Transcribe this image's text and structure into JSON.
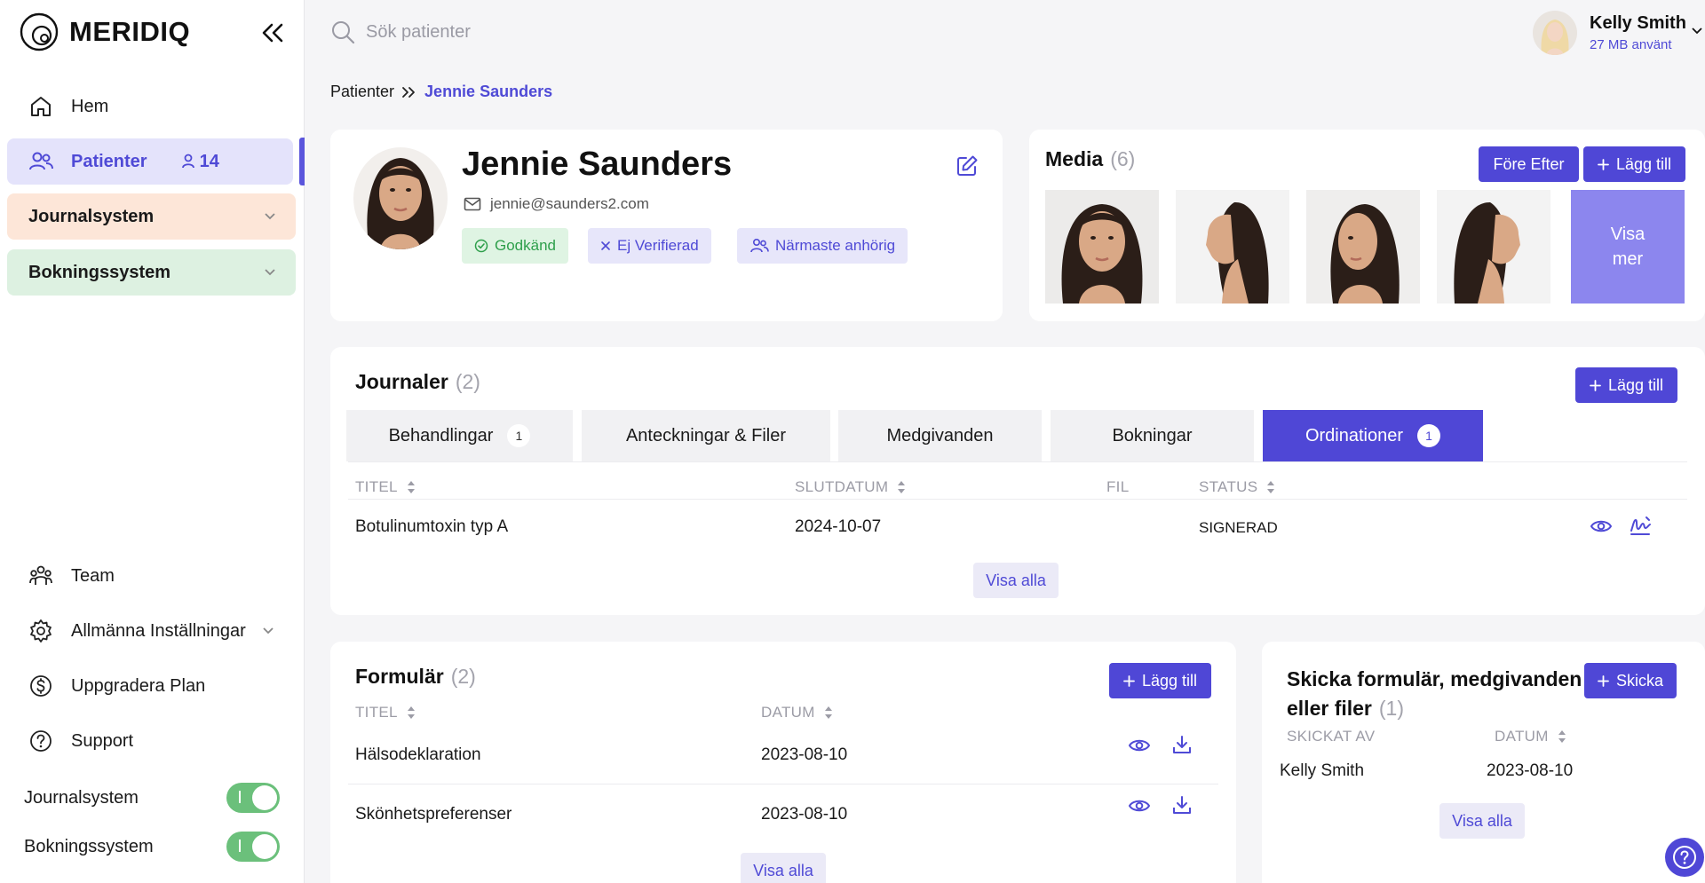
{
  "app": {
    "brand": "MERIDIQ",
    "accent_color": "#4f47d6",
    "collapse_icon": "double-chevron-left-icon"
  },
  "sidebar": {
    "items": [
      {
        "label": "Hem",
        "icon": "home-icon"
      },
      {
        "label": "Patienter",
        "icon": "users-icon",
        "count": "14",
        "count_icon": "user-icon"
      }
    ],
    "groups": [
      {
        "label": "Journalsystem",
        "color": "#fde6d8"
      },
      {
        "label": "Bokningssystem",
        "color": "#ddf1e1"
      }
    ],
    "bottom_items": [
      {
        "label": "Team",
        "icon": "team-icon"
      },
      {
        "label": "Allmänna Inställningar",
        "icon": "gear-icon"
      },
      {
        "label": "Uppgradera Plan",
        "icon": "dollar-icon"
      },
      {
        "label": "Support",
        "icon": "help-circle-icon"
      }
    ],
    "toggles": [
      {
        "label": "Journalsystem",
        "on": true
      },
      {
        "label": "Bokningssystem",
        "on": true
      }
    ]
  },
  "topbar": {
    "search_placeholder": "Sök patienter",
    "user_name": "Kelly Smith",
    "user_storage": "27 MB använt"
  },
  "breadcrumb": {
    "root": "Patienter",
    "current": "Jennie Saunders"
  },
  "patient": {
    "name": "Jennie Saunders",
    "email": "jennie@saunders2.com",
    "tags": {
      "approved": "Godkänd",
      "not_verified": "Ej Verifierad",
      "next_of_kin": "Närmaste anhörig"
    }
  },
  "media": {
    "title": "Media",
    "count": "(6)",
    "before_after_label": "Före Efter",
    "add_label": "Lägg till",
    "more_label_1": "Visa",
    "more_label_2": "mer"
  },
  "journals": {
    "title": "Journaler",
    "count": "(2)",
    "add_label": "Lägg till",
    "tabs": [
      {
        "label": "Behandlingar",
        "badge": "1"
      },
      {
        "label": "Anteckningar & Filer",
        "badge": ""
      },
      {
        "label": "Medgivanden",
        "badge": ""
      },
      {
        "label": "Bokningar",
        "badge": ""
      },
      {
        "label": "Ordinationer",
        "badge": "1",
        "active": true
      }
    ],
    "columns": {
      "title": "TITEL",
      "end_date": "SLUTDATUM",
      "file": "FIL",
      "status": "STATUS"
    },
    "rows": [
      {
        "title": "Botulinumtoxin typ A",
        "end_date": "2024-10-07",
        "file": "",
        "status": "SIGNERAD"
      }
    ],
    "show_all": "Visa alla"
  },
  "forms": {
    "title": "Formulär",
    "count": "(2)",
    "add_label": "Lägg till",
    "columns": {
      "title": "TITEL",
      "date": "DATUM"
    },
    "rows": [
      {
        "title": "Hälsodeklaration",
        "date": "2023-08-10"
      },
      {
        "title": "Skönhetspreferenser",
        "date": "2023-08-10"
      }
    ],
    "show_all": "Visa alla"
  },
  "send": {
    "title_line1": "Skicka formulär, medgivanden",
    "title_line2": "eller filer",
    "count": "(1)",
    "send_label": "Skicka",
    "columns": {
      "sent_by": "SKICKAT AV",
      "date": "DATUM"
    },
    "rows": [
      {
        "sent_by": "Kelly Smith",
        "date": "2023-08-10"
      }
    ],
    "show_all": "Visa alla"
  }
}
